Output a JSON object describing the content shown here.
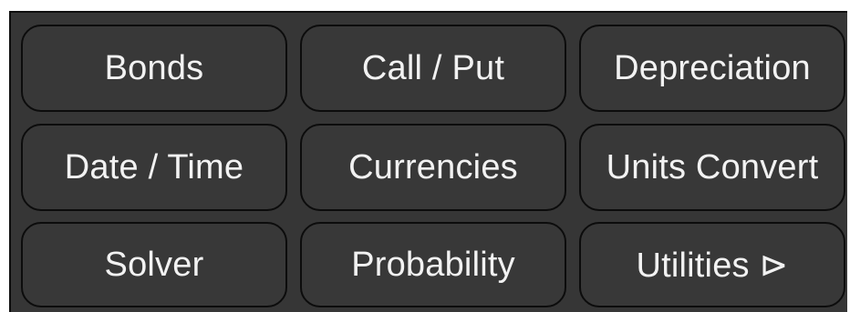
{
  "keypad": {
    "buttons": [
      {
        "label": "Bonds"
      },
      {
        "label": "Call / Put"
      },
      {
        "label": "Depreciation"
      },
      {
        "label": "Date / Time"
      },
      {
        "label": "Currencies"
      },
      {
        "label": "Units Convert"
      },
      {
        "label": "Solver"
      },
      {
        "label": "Probability"
      },
      {
        "label": "Utilities ⊳"
      }
    ]
  },
  "colors": {
    "background": "#363636",
    "button_fill": "#383838",
    "button_border": "#0c0c0c",
    "text": "#f2f2f2"
  }
}
